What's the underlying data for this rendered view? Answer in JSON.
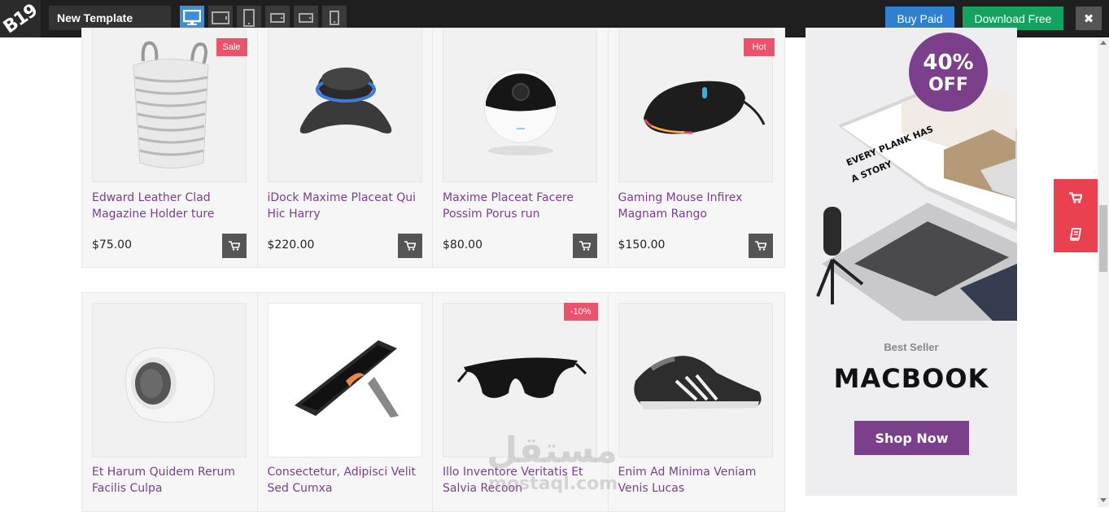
{
  "topbar": {
    "logo_text": "B19",
    "template_name": "New Template",
    "devices": [
      "desktop-icon",
      "laptop-icon",
      "tablet-icon",
      "tablet-landscape-icon",
      "phone-landscape-icon",
      "phone-icon"
    ],
    "buy_paid_label": "Buy Paid",
    "download_free_label": "Download Free",
    "close_label": "✖"
  },
  "row1": [
    {
      "name": "Edward Leather Clad Magazine Holder ture",
      "price": "$75.00",
      "badge": "Sale"
    },
    {
      "name": "iDock Maxime Placeat Qui Hic Harry",
      "price": "$220.00",
      "badge": ""
    },
    {
      "name": "Maxime Placeat Facere Possim Porus run",
      "price": "$80.00",
      "badge": ""
    },
    {
      "name": "Gaming Mouse Infirex Magnam Rango",
      "price": "$150.00",
      "badge": "Hot"
    }
  ],
  "row2": [
    {
      "name": "Et Harum Quidem Rerum Facilis Culpa",
      "badge": ""
    },
    {
      "name": "Consectetur, Adipisci Velit Sed Cumxa",
      "badge": ""
    },
    {
      "name": "Illo Inventore Veritatis Et Salvia Recoon",
      "badge": "-10%"
    },
    {
      "name": "Enim Ad Minima Veniam Venis Lucas",
      "badge": ""
    }
  ],
  "banner": {
    "discount": "40%",
    "discount_word": "OFF",
    "screen_text": "EVERY PLANK HAS A STORY",
    "subtitle": "Best Seller",
    "title": "MACBOOK",
    "button_label": "Shop Now"
  },
  "watermark": {
    "arabic": "مستقل",
    "latin": "mostaql.com"
  },
  "colors": {
    "accent": "#7b3f8c",
    "badge": "#e9536c",
    "side_buttons": "#e9414f",
    "buy_paid": "#2f80d1",
    "download_free": "#15a15f"
  }
}
